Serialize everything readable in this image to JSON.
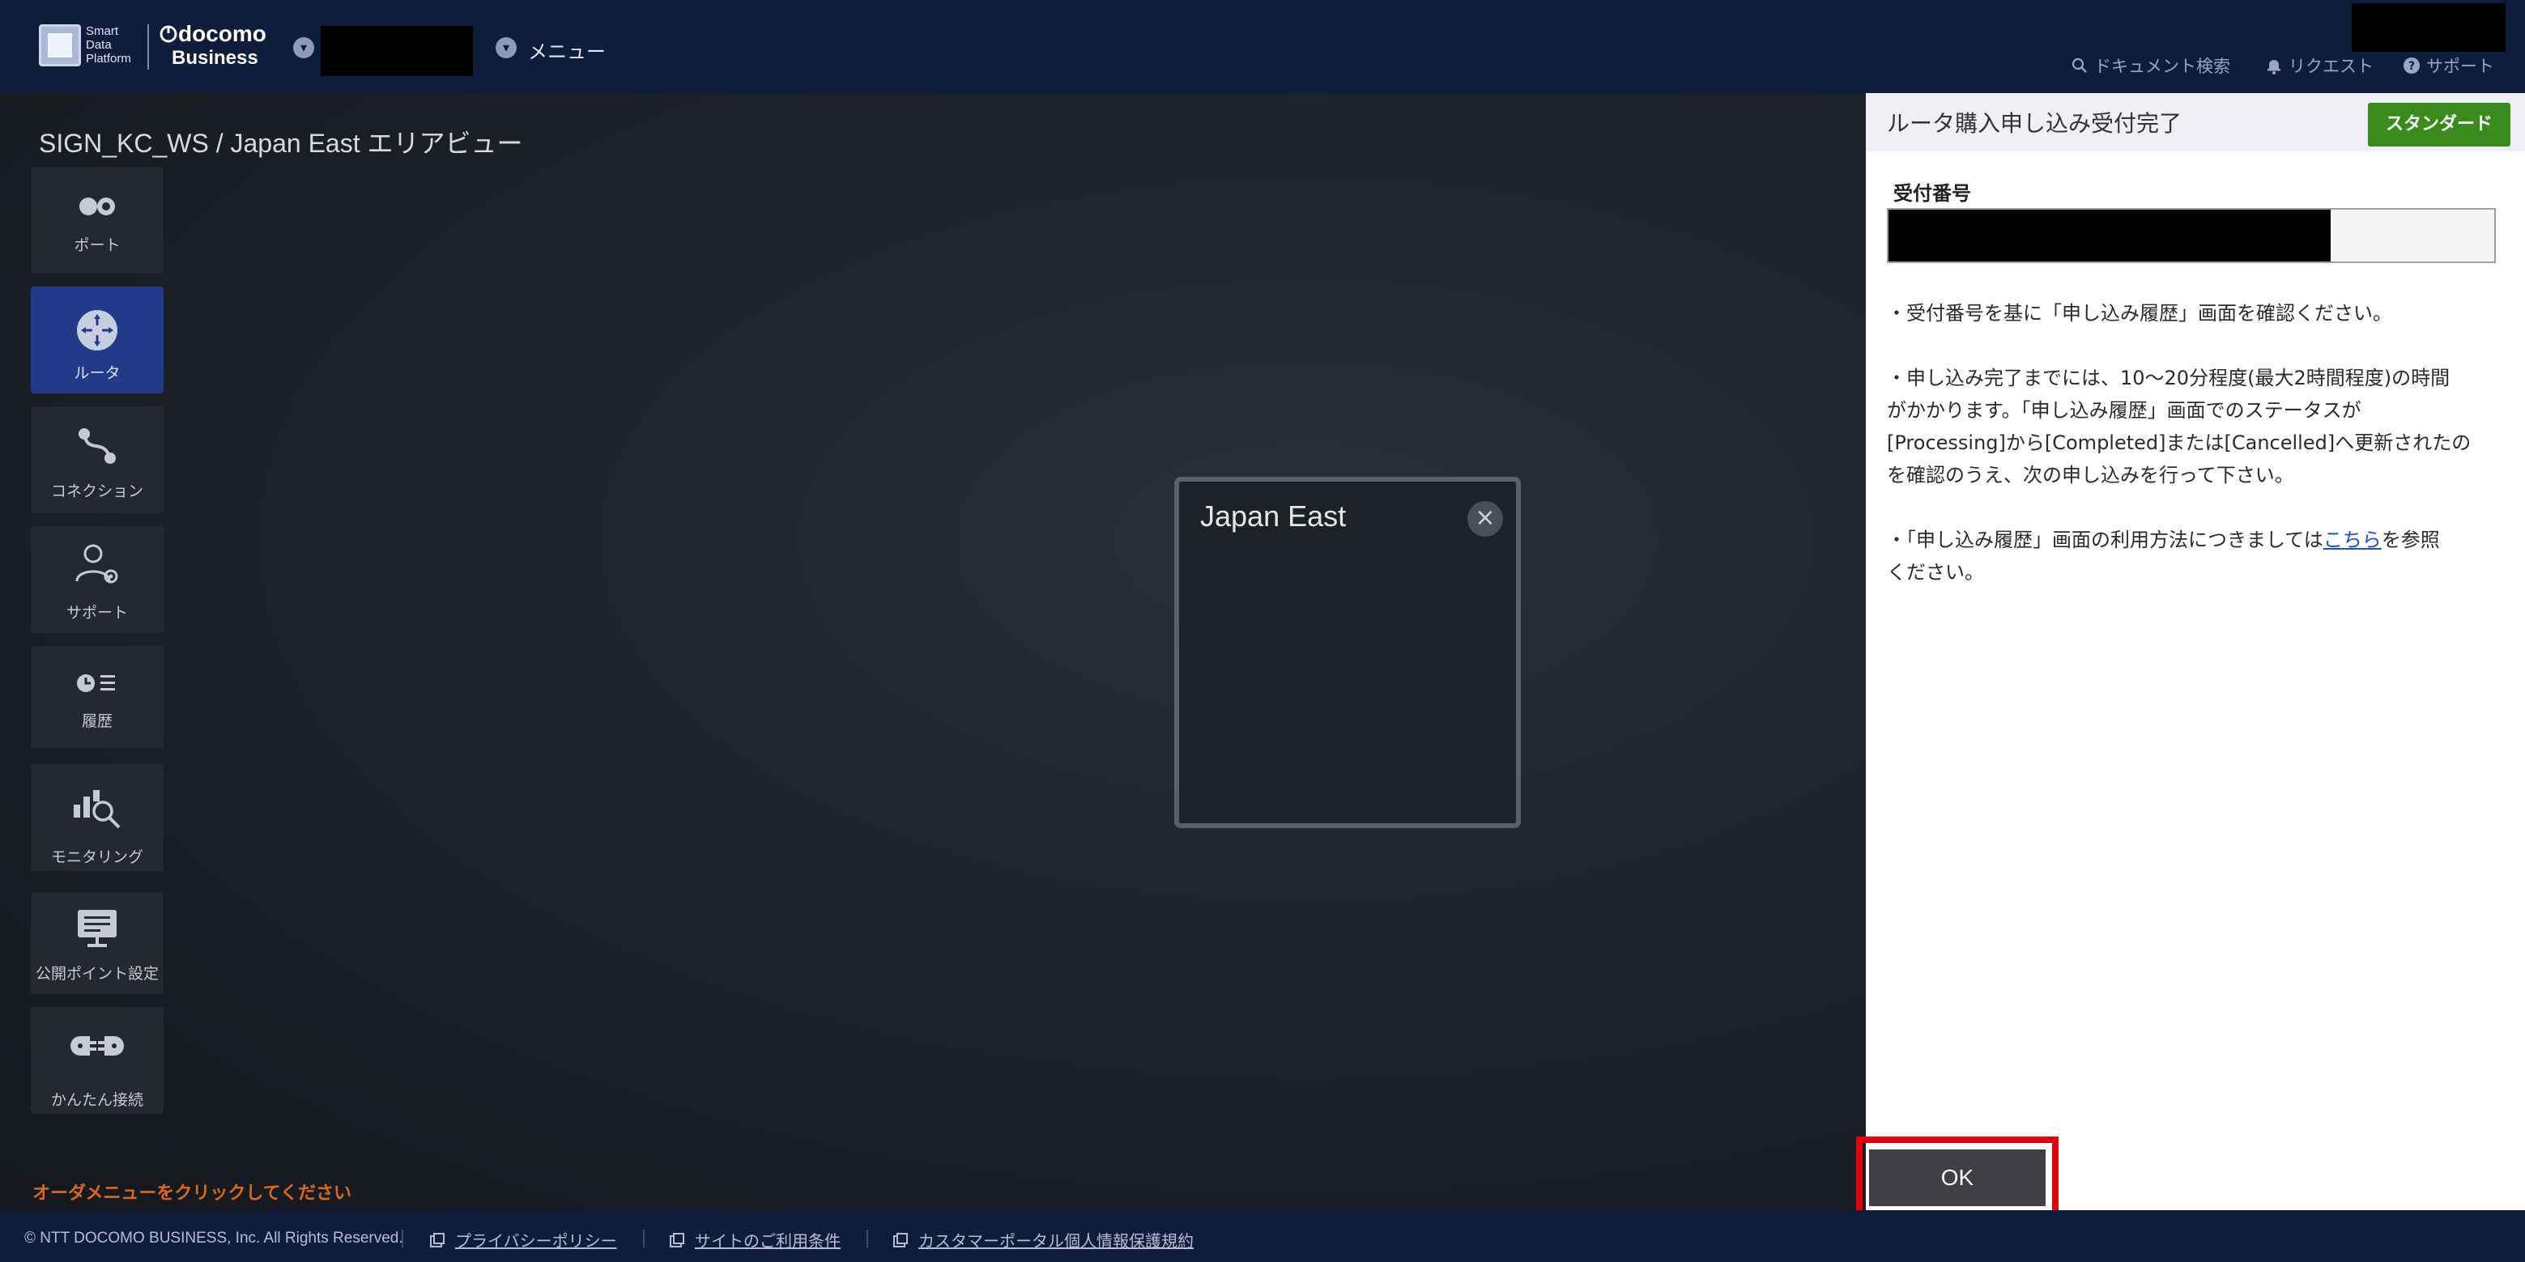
{
  "header": {
    "logo_sdp_line1": "Smart",
    "logo_sdp_line2": "Data",
    "logo_sdp_line3": "Platform",
    "logo_docomo": "docomo",
    "logo_business": "Business",
    "menu_label": "メニュー",
    "links": {
      "doc_search": "ドキュメント検索",
      "request": "リクエスト",
      "support": "サポート"
    }
  },
  "breadcrumb": "SIGN_KC_WS / Japan East エリアビュー",
  "sidebar": {
    "items": [
      {
        "label": "ポート",
        "icon": "port-icon"
      },
      {
        "label": "ルータ",
        "icon": "router-icon"
      },
      {
        "label": "コネクション",
        "icon": "connection-icon"
      },
      {
        "label": "サポート",
        "icon": "support-person-icon"
      },
      {
        "label": "履歴",
        "icon": "history-icon"
      },
      {
        "label": "モニタリング",
        "icon": "monitoring-icon"
      },
      {
        "label": "公開ポイント設定",
        "icon": "public-point-icon"
      },
      {
        "label": "かんたん接続",
        "icon": "easy-connect-icon"
      }
    ],
    "active_index": 1
  },
  "order_hint": "オーダメニューをクリックしてください",
  "area_popup": {
    "title": "Japan East"
  },
  "panel": {
    "title": "ルータ購入申し込み受付完了",
    "badge": "スタンダード",
    "field_label": "受付番号",
    "para1": "・受付番号を基に「申し込み履歴」画面を確認ください。",
    "para2_line1": "・申し込み完了までには、10〜20分程度(最大2時間程度)の時間",
    "para2_line2": "がかかります。「申し込み履歴」画面でのステータスが",
    "para2_line3": "[Processing]から[Completed]または[Cancelled]へ更新されたの",
    "para2_line4": "を確認のうえ、次の申し込みを行って下さい。",
    "para3_prefix": "・「申し込み履歴」画面の利用方法につきましては",
    "para3_link": "こちら",
    "para3_suffix": "を参照",
    "para3_line2": "ください。",
    "ok_label": "OK"
  },
  "footer": {
    "copyright": "© NTT DOCOMO BUSINESS, Inc. All Rights Reserved.",
    "privacy": "プライバシーポリシー",
    "terms": "サイトのご利用条件",
    "portal_privacy": "カスタマーポータル個人情報保護規約"
  },
  "colors": {
    "header_bg": "#0d1d3b",
    "active_nav": "#233a8a",
    "badge_green": "#3b8a1d",
    "ok_highlight": "#e0000f",
    "hint_orange": "#d9691c",
    "link_blue": "#1a4fd6"
  }
}
